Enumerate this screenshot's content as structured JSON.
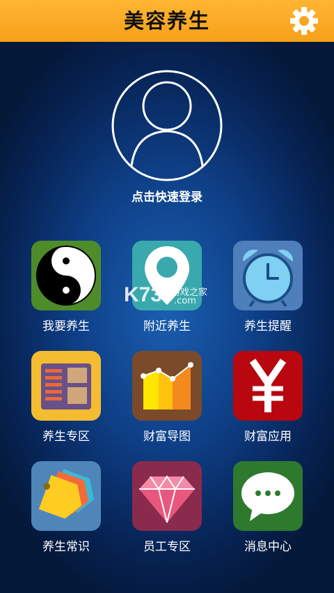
{
  "header": {
    "title": "美容养生",
    "settings_icon": "gear-icon",
    "bg_color": "#f8a820"
  },
  "profile": {
    "avatar_icon": "user-avatar-icon",
    "login_label": "点击快速登录"
  },
  "grid": {
    "items": [
      {
        "label": "我要养生",
        "icon": "yin-yang-icon",
        "color": "#4e8c2a"
      },
      {
        "label": "附近养生",
        "icon": "location-pin-icon",
        "color": "#3aa9ad"
      },
      {
        "label": "养生提醒",
        "icon": "alarm-clock-icon",
        "color": "#4e7fba"
      },
      {
        "label": "养生专区",
        "icon": "layout-board-icon",
        "color": "#f4bc30"
      },
      {
        "label": "财富导图",
        "icon": "bar-chart-icon",
        "color": "#7a4a2a"
      },
      {
        "label": "财富应用",
        "icon": "yen-icon",
        "color": "#b8070f"
      },
      {
        "label": "养生常识",
        "icon": "tags-icon",
        "color": "#4f86ba"
      },
      {
        "label": "员工专区",
        "icon": "diamond-icon",
        "color": "#8a2a4c"
      },
      {
        "label": "消息中心",
        "icon": "chat-bubble-icon",
        "color": "#2d7a2e"
      }
    ]
  },
  "watermark": {
    "brand": "K73",
    "site_text": "游戏之家",
    "domain": ".com"
  }
}
